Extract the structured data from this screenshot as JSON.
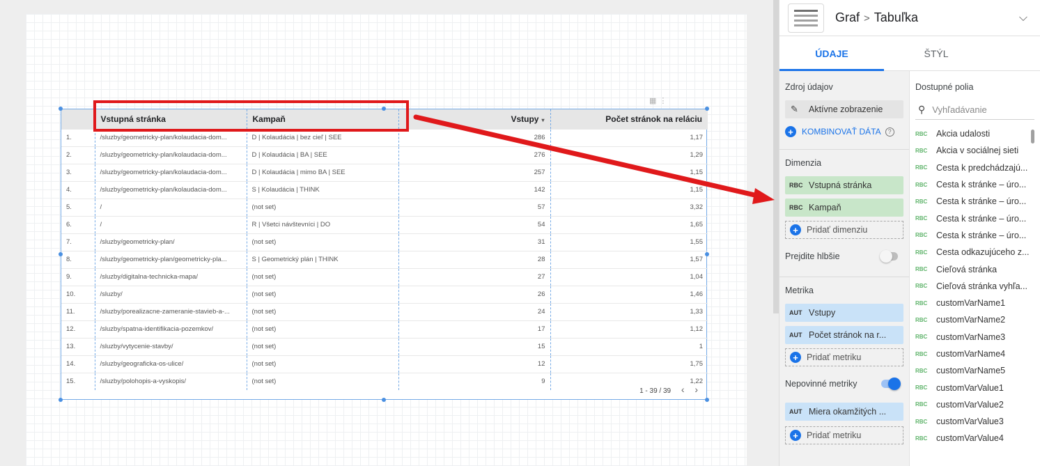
{
  "table": {
    "headers": {
      "index": "",
      "landing": "Vstupná stránka",
      "campaign": "Kampaň",
      "entries": "Vstupy",
      "pages": "Počet stránok na reláciu"
    },
    "sort_icon": "▾",
    "rows": [
      {
        "index": "1.",
        "landing": "/sluzby/geometricky-plan/kolaudacia-dom...",
        "campaign": "D | Kolaudácia | bez cieľ | SEE",
        "entries": "286",
        "pages": "1,17"
      },
      {
        "index": "2.",
        "landing": "/sluzby/geometricky-plan/kolaudacia-dom...",
        "campaign": "D | Kolaudácia | BA | SEE",
        "entries": "276",
        "pages": "1,29"
      },
      {
        "index": "3.",
        "landing": "/sluzby/geometricky-plan/kolaudacia-dom...",
        "campaign": "D | Kolaudácia | mimo BA | SEE",
        "entries": "257",
        "pages": "1,15"
      },
      {
        "index": "4.",
        "landing": "/sluzby/geometricky-plan/kolaudacia-dom...",
        "campaign": "S | Kolaudácia | THINK",
        "entries": "142",
        "pages": "1,15"
      },
      {
        "index": "5.",
        "landing": "/",
        "campaign": "(not set)",
        "entries": "57",
        "pages": "3,32"
      },
      {
        "index": "6.",
        "landing": "/",
        "campaign": "R | Všetci návštevníci | DO",
        "entries": "54",
        "pages": "1,65"
      },
      {
        "index": "7.",
        "landing": "/sluzby/geometricky-plan/",
        "campaign": "(not set)",
        "entries": "31",
        "pages": "1,55"
      },
      {
        "index": "8.",
        "landing": "/sluzby/geometricky-plan/geometricky-pla...",
        "campaign": "S | Geometrický plán | THINK",
        "entries": "28",
        "pages": "1,57"
      },
      {
        "index": "9.",
        "landing": "/sluzby/digitalna-technicka-mapa/",
        "campaign": "(not set)",
        "entries": "27",
        "pages": "1,04"
      },
      {
        "index": "10.",
        "landing": "/sluzby/",
        "campaign": "(not set)",
        "entries": "26",
        "pages": "1,46"
      },
      {
        "index": "11.",
        "landing": "/sluzby/porealizacne-zameranie-stavieb-a-...",
        "campaign": "(not set)",
        "entries": "24",
        "pages": "1,33"
      },
      {
        "index": "12.",
        "landing": "/sluzby/spatna-identifikacia-pozemkov/",
        "campaign": "(not set)",
        "entries": "17",
        "pages": "1,12"
      },
      {
        "index": "13.",
        "landing": "/sluzby/vytycenie-stavby/",
        "campaign": "(not set)",
        "entries": "15",
        "pages": "1"
      },
      {
        "index": "14.",
        "landing": "/sluzby/geograficka-os-ulice/",
        "campaign": "(not set)",
        "entries": "12",
        "pages": "1,75"
      },
      {
        "index": "15.",
        "landing": "/sluzby/polohopis-a-vyskopis/",
        "campaign": "(not set)",
        "entries": "9",
        "pages": "1,22"
      }
    ],
    "pager": {
      "range": "1 - 39 / 39",
      "prev": "‹",
      "next": "›"
    }
  },
  "panel": {
    "title_part1": "Graf",
    "title_sep": ">",
    "title_part2": "Tabuľka",
    "chevron": "⌵",
    "tabs": {
      "data": "ÚDAJE",
      "style": "ŠTÝL"
    },
    "source": {
      "label": "Zdroj údajov",
      "name": "Aktívne zobrazenie",
      "blend": "KOMBINOVAŤ DÁTA"
    },
    "dimension": {
      "label": "Dimenzia",
      "items": [
        "Vstupná stránka",
        "Kampaň"
      ],
      "add": "Pridať dimenziu",
      "type": "RBC"
    },
    "drill": {
      "label": "Prejdite hlbšie"
    },
    "metric": {
      "label": "Metrika",
      "items": [
        "Vstupy",
        "Počet stránok na r..."
      ],
      "add": "Pridať metriku",
      "type": "AUT"
    },
    "optional": {
      "label": "Nepovinné metriky",
      "items": [
        "Miera okamžitých ..."
      ],
      "add": "Pridať metriku"
    },
    "available": {
      "label": "Dostupné polia",
      "search_placeholder": "Vyhľadávanie",
      "type": "RBC",
      "fields": [
        "Akcia udalosti",
        "Akcia v sociálnej sieti",
        "Cesta k predchádzajú...",
        "Cesta k stránke – úro...",
        "Cesta k stránke – úro...",
        "Cesta k stránke – úro...",
        "Cesta k stránke – úro...",
        "Cesta odkazujúceho z...",
        "Cieľová stránka",
        "Cieľová stránka vyhľa...",
        "customVarName1",
        "customVarName2",
        "customVarName3",
        "customVarName4",
        "customVarName5",
        "customVarValue1",
        "customVarValue2",
        "customVarValue3",
        "customVarValue4"
      ]
    }
  },
  "colors": {
    "accent": "#1a73e8",
    "highlight": "#e0191b",
    "dimension_chip": "#c8e6c9",
    "metric_chip": "#c9e2f8"
  }
}
